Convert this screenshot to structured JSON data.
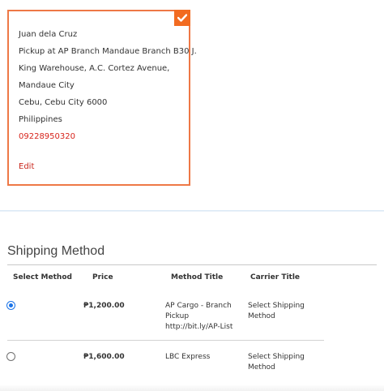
{
  "address": {
    "lines": [
      "Juan dela Cruz",
      "Pickup at AP Branch Mandaue Branch B30 J.",
      "King Warehouse, A.C. Cortez Avenue,",
      "Mandaue City",
      "Cebu, Cebu City 6000",
      "Philippines"
    ],
    "phone": "09228950320",
    "edit_label": "Edit",
    "selected": true
  },
  "shipping": {
    "title": "Shipping Method",
    "columns": [
      "Select Method",
      "Price",
      "Method Title",
      "Carrier Title"
    ],
    "rows": [
      {
        "selected": true,
        "price": "₱1,200.00",
        "method_lines": [
          "AP Cargo - Branch",
          "Pickup",
          "http://bit.ly/AP-List"
        ],
        "carrier_lines": [
          "Select Shipping",
          "Method"
        ]
      },
      {
        "selected": false,
        "price": "₱1,600.00",
        "method_lines": [
          "LBC Express"
        ],
        "carrier_lines": [
          "Select Shipping",
          "Method"
        ]
      }
    ]
  },
  "colors": {
    "card_border": "#ee7846",
    "check_badge": "#f26b21",
    "phone_text": "#d7241c",
    "radio_active": "#1a73e8"
  }
}
